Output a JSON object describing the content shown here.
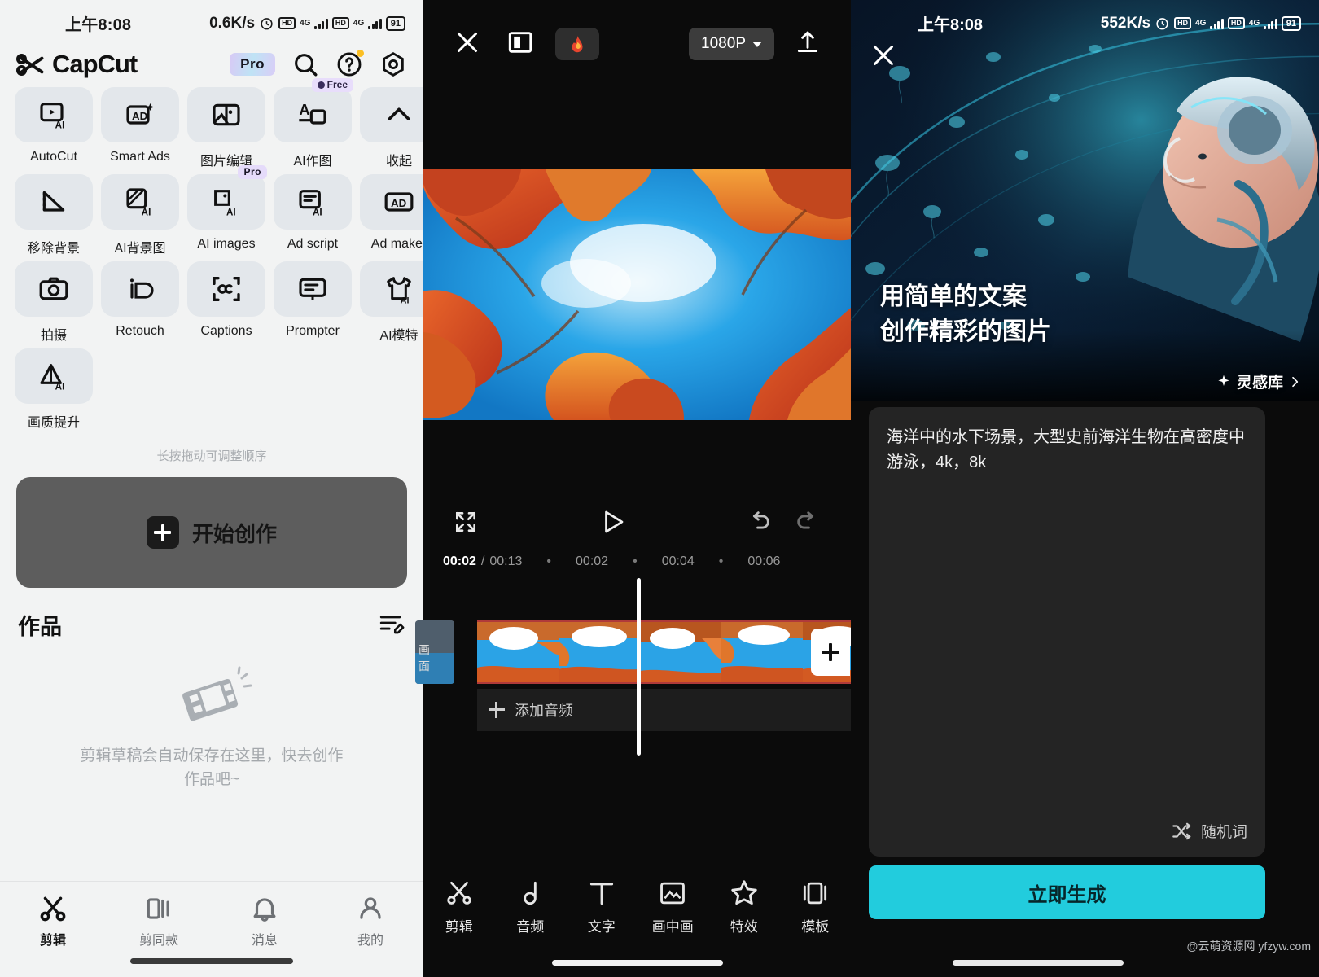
{
  "panel1": {
    "status": {
      "time": "上午8:08",
      "netspeed": "0.6K/s",
      "hd1": "HD",
      "net1": "4G",
      "hd2": "HD",
      "net2": "4G",
      "battery": "91"
    },
    "header": {
      "app_name": "CapCut",
      "pro_label": "Pro",
      "icons": [
        "search-icon",
        "help-icon",
        "settings-icon"
      ]
    },
    "tools": [
      {
        "label": "AutoCut",
        "icon": "autocut-ai-icon",
        "badge": ""
      },
      {
        "label": "Smart Ads",
        "icon": "smart-ads-icon",
        "badge": ""
      },
      {
        "label": "图片编辑",
        "icon": "image-edit-icon",
        "badge": ""
      },
      {
        "label": "AI作图",
        "icon": "ai-draw-icon",
        "badge": "Free"
      },
      {
        "label": "收起",
        "icon": "chevron-up-icon",
        "badge": ""
      },
      {
        "label": "移除背景",
        "icon": "remove-background-icon",
        "badge": ""
      },
      {
        "label": "AI背景图",
        "icon": "ai-background-icon",
        "badge": ""
      },
      {
        "label": "AI images",
        "icon": "ai-images-icon",
        "badge": "Pro"
      },
      {
        "label": "Ad script",
        "icon": "ad-script-icon",
        "badge": ""
      },
      {
        "label": "Ad maker",
        "icon": "ad-maker-icon",
        "badge": ""
      },
      {
        "label": "拍摄",
        "icon": "camera-icon",
        "badge": ""
      },
      {
        "label": "Retouch",
        "icon": "retouch-icon",
        "badge": ""
      },
      {
        "label": "Captions",
        "icon": "captions-icon",
        "badge": ""
      },
      {
        "label": "Prompter",
        "icon": "prompter-icon",
        "badge": ""
      },
      {
        "label": "AI模特",
        "icon": "ai-model-icon",
        "badge": ""
      },
      {
        "label": "画质提升",
        "icon": "quality-enhance-icon",
        "badge": ""
      }
    ],
    "reorder_hint": "长按拖动可调整顺序",
    "create_button": "开始创作",
    "works": {
      "title": "作品",
      "empty_text": "剪辑草稿会自动保存在这里，快去创作\n作品吧~"
    },
    "tabs": [
      {
        "label": "剪辑",
        "icon": "scissors-icon",
        "active": true
      },
      {
        "label": "剪同款",
        "icon": "template-icon",
        "active": false
      },
      {
        "label": "消息",
        "icon": "bell-icon",
        "active": false
      },
      {
        "label": "我的",
        "icon": "person-icon",
        "active": false
      }
    ]
  },
  "panel2": {
    "topbar": {
      "close": "close-icon",
      "ratio": "aspect-ratio-icon",
      "flame": "flame-icon",
      "resolution": "1080P",
      "export": "export-icon"
    },
    "controls": {
      "fullscreen": "fullscreen-icon",
      "play": "play-icon",
      "undo": "undo-icon",
      "redo": "redo-icon"
    },
    "timeline": {
      "current": "00:02",
      "separator": "/",
      "total": "00:13",
      "ticks": [
        "00:02",
        "00:04",
        "00:06"
      ],
      "add_audio": "添加音频"
    },
    "toolbar": [
      {
        "label": "剪辑",
        "icon": "scissors-icon"
      },
      {
        "label": "音频",
        "icon": "music-note-icon"
      },
      {
        "label": "文字",
        "icon": "text-icon"
      },
      {
        "label": "画中画",
        "icon": "picture-in-picture-icon"
      },
      {
        "label": "特效",
        "icon": "effects-star-icon"
      },
      {
        "label": "模板",
        "icon": "template-icon"
      }
    ]
  },
  "panel3": {
    "status": {
      "time": "上午8:08",
      "netspeed": "552K/s",
      "hd1": "HD",
      "net1": "4G",
      "hd2": "HD",
      "net2": "4G",
      "battery": "91"
    },
    "close": "close-icon",
    "hero_title_line1": "用简单的文案",
    "hero_title_line2": "创作精彩的图片",
    "inspiration": "灵感库",
    "prompt": "海洋中的水下场景，大型史前海洋生物在高密度中游泳，4k，8k",
    "random_words": "随机词",
    "generate_button": "立即生成",
    "watermark": "@云萌资源网 yfzyw.com"
  },
  "colors": {
    "accent_cyan": "#22ccdd",
    "pro_badge": "#e5dbfa",
    "panel_light": "#f2f3f3",
    "panel_dark": "#0b0b0b"
  }
}
